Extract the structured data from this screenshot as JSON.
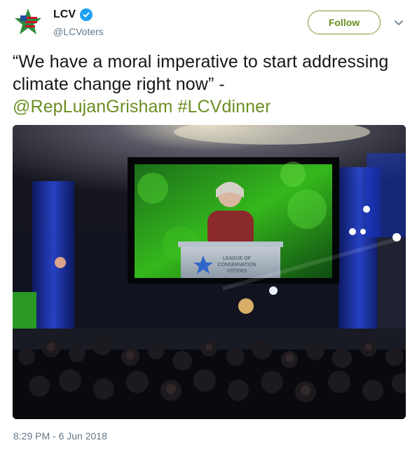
{
  "account": {
    "display_name": "LCV",
    "handle": "@LCVoters",
    "avatar_icon": "lcv-star-logo",
    "verified_icon": "verified-badge-icon"
  },
  "actions": {
    "follow_label": "Follow",
    "more_icon": "chevron-down-icon"
  },
  "tweet": {
    "text_main": "“We have a moral imperative to start addressing climate change right now” -",
    "mention": "@RepLujanGrisham",
    "hashtag": "#LCVdinner",
    "timestamp": "8:29 PM - 6 Jun 2018"
  },
  "media": {
    "type": "photo",
    "podium_sign_text": "LEAGUE OF CONSERVATION VOTERS"
  },
  "colors": {
    "link": "#6b8f22",
    "verified": "#1da1f2",
    "muted": "#657786"
  }
}
